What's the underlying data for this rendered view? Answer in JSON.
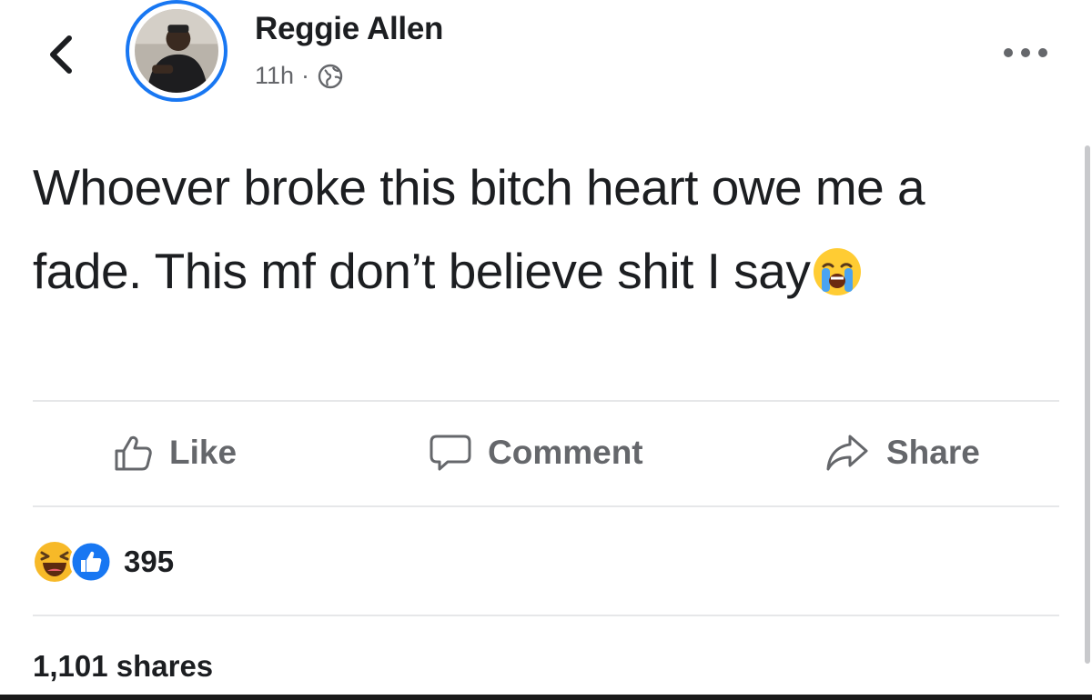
{
  "header": {
    "back_icon": "chevron-left-icon",
    "author_name": "Reggie Allen",
    "timestamp": "11h",
    "separator": "·",
    "privacy_icon": "globe-icon",
    "more_icon": "more-dots-icon"
  },
  "post": {
    "text": "Whoever broke this bitch heart owe me a fade. This mf don’t believe shit I say",
    "emoji": "loudly-crying-face"
  },
  "actions": {
    "like_label": "Like",
    "comment_label": "Comment",
    "share_label": "Share"
  },
  "reactions": {
    "types": [
      "haha",
      "like"
    ],
    "count": "395"
  },
  "shares": {
    "label": "1,101 shares"
  },
  "colors": {
    "accent": "#1877f2",
    "text": "#1c1e21",
    "secondary": "#65676b",
    "divider": "#e6e7e9"
  }
}
